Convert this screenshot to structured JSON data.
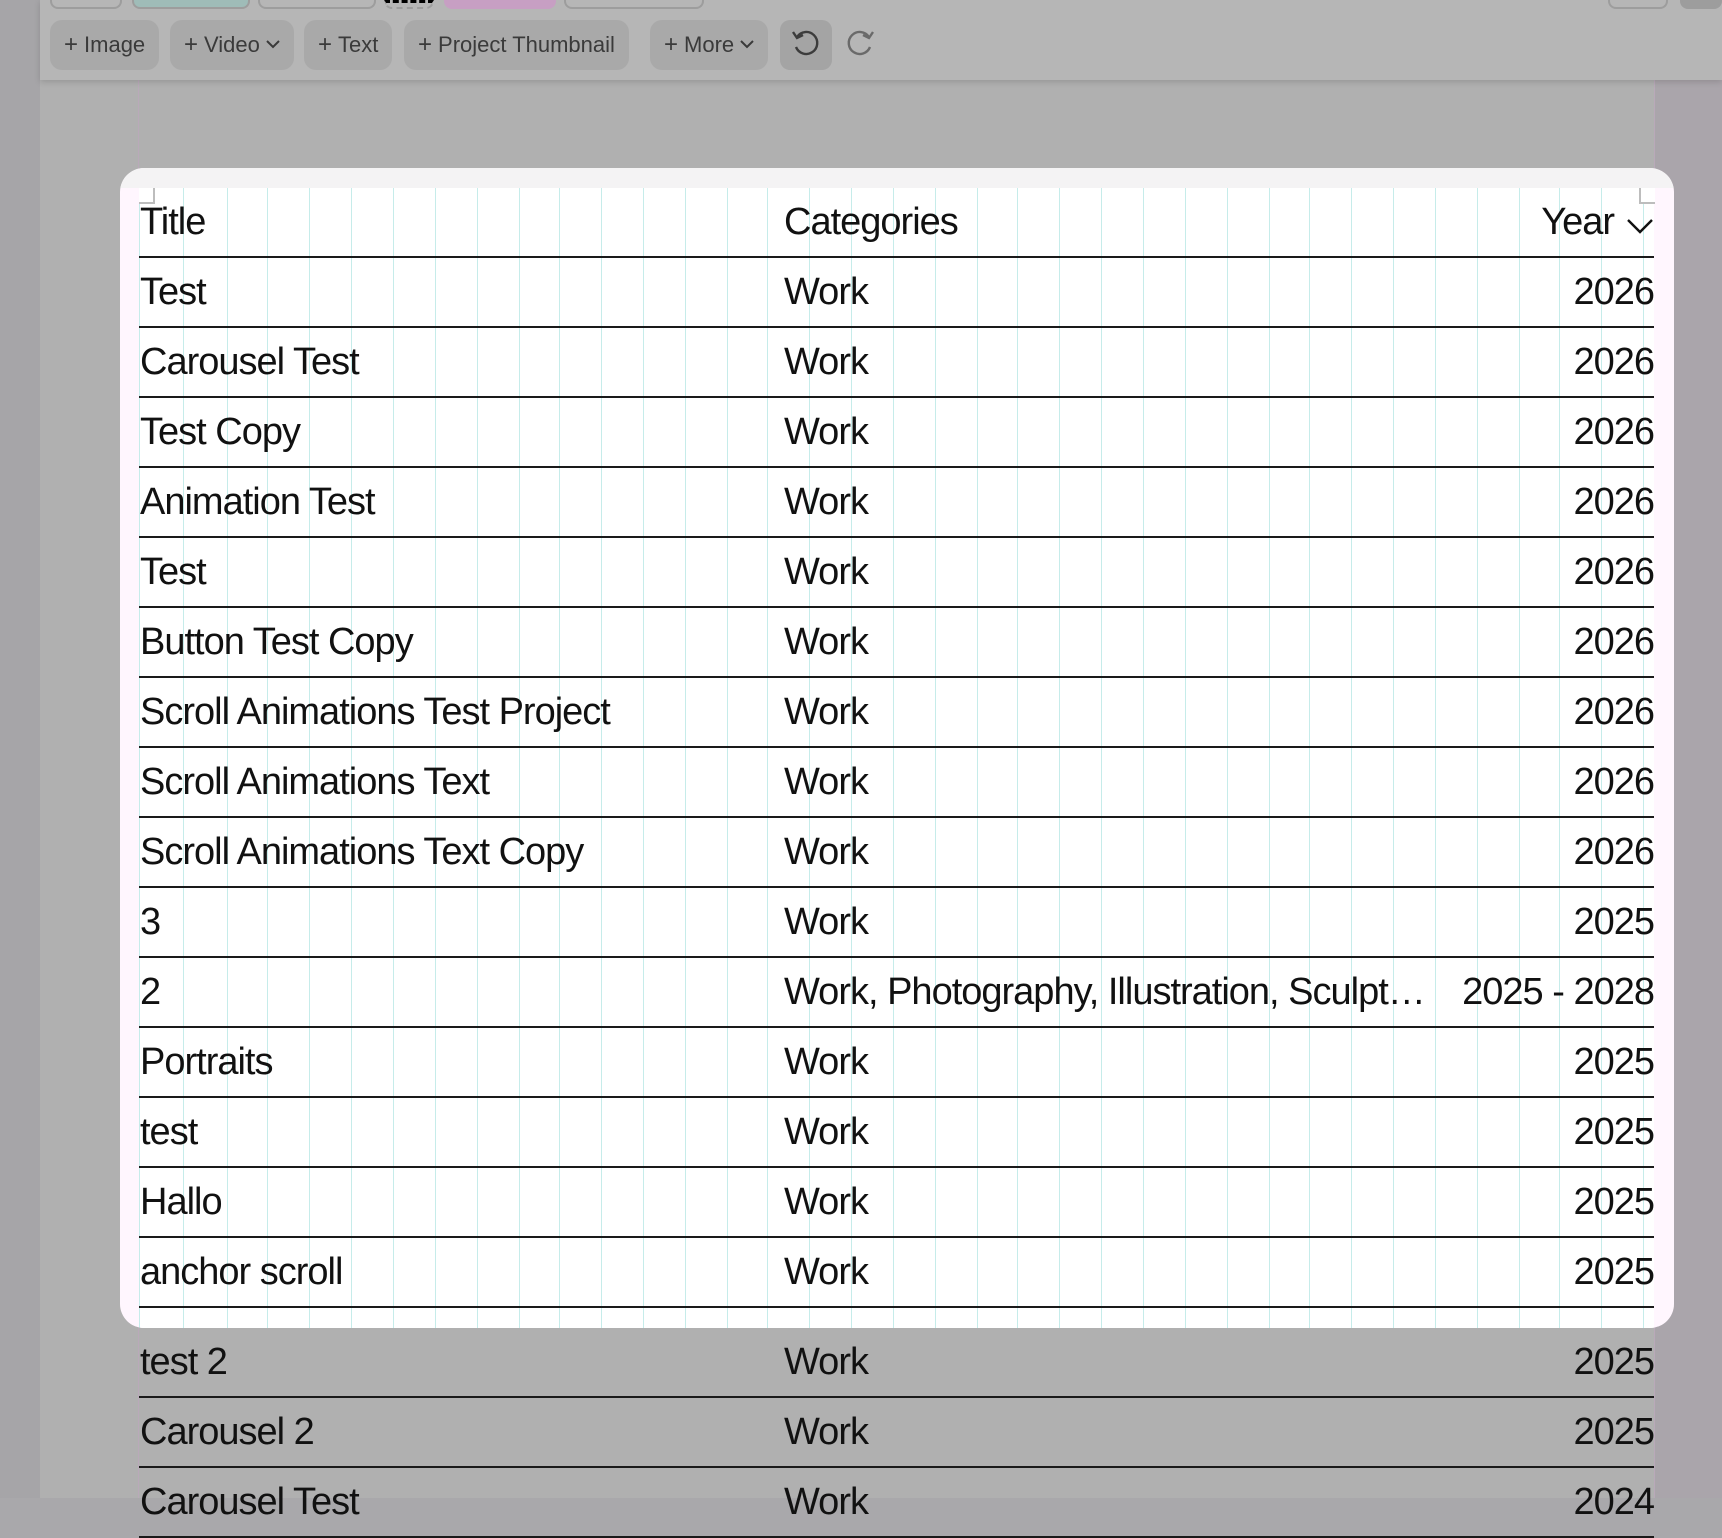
{
  "toolbar": {
    "add_image": "Image",
    "add_video": "Video",
    "add_text": "Text",
    "add_project_thumbnail": "Project Thumbnail",
    "more": "More",
    "plus_glyph": "+",
    "icons": [
      "plus-icon",
      "chevron-down-icon",
      "undo-icon",
      "redo-icon"
    ]
  },
  "table": {
    "columns": {
      "title": "Title",
      "categories": "Categories",
      "year": "Year"
    },
    "sort_icon": "chevron-down-icon",
    "rows": [
      {
        "title": "Test",
        "categories": "Work",
        "year": "2026"
      },
      {
        "title": "Carousel Test",
        "categories": "Work",
        "year": "2026"
      },
      {
        "title": "Test Copy",
        "categories": "Work",
        "year": "2026"
      },
      {
        "title": "Animation Test",
        "categories": "Work",
        "year": "2026"
      },
      {
        "title": "Test",
        "categories": "Work",
        "year": "2026"
      },
      {
        "title": "Button Test Copy",
        "categories": "Work",
        "year": "2026"
      },
      {
        "title": "Scroll Animations Test Project",
        "categories": "Work",
        "year": "2026"
      },
      {
        "title": "Scroll Animations Text",
        "categories": "Work",
        "year": "2026"
      },
      {
        "title": "Scroll Animations Text Copy",
        "categories": "Work",
        "year": "2026"
      },
      {
        "title": "3",
        "categories": "Work",
        "year": "2025"
      },
      {
        "title": "2",
        "categories": "Work, Photography, Illustration, Sculpt…",
        "year": "2025 - 2028"
      },
      {
        "title": "Portraits",
        "categories": "Work",
        "year": "2025"
      },
      {
        "title": "test",
        "categories": "Work",
        "year": "2025"
      },
      {
        "title": "Hallo",
        "categories": "Work",
        "year": "2025"
      },
      {
        "title": "anchor scroll",
        "categories": "Work",
        "year": "2025"
      },
      {
        "title": "test 2",
        "categories": "Work",
        "year": "2025"
      },
      {
        "title": "Carousel 2",
        "categories": "Work",
        "year": "2025"
      },
      {
        "title": "Carousel Test",
        "categories": "Work",
        "year": "2024"
      }
    ]
  },
  "colors": {
    "overlay": "#b0b0b0",
    "panel_bg": "#fff6fe",
    "grid_line": "#c6ecea",
    "row_border": "#1a1a1a"
  }
}
